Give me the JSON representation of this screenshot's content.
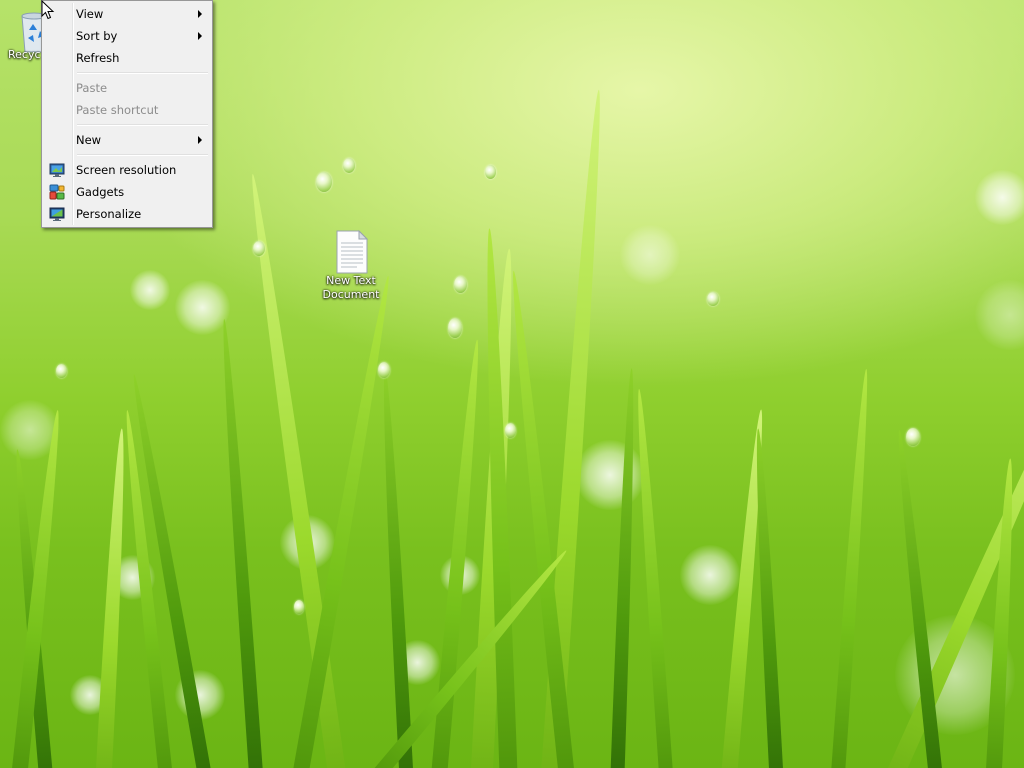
{
  "desktop": {
    "icons": [
      {
        "label": "Recycle Bin",
        "visible_label": "Recyc",
        "icon": "recycle-bin-icon"
      },
      {
        "label": "New Text Document",
        "line1": "New Text",
        "line2": "Document",
        "icon": "text-document-icon"
      }
    ],
    "wallpaper": {
      "accent": "#8fcf2e"
    }
  },
  "context_menu": {
    "items": [
      {
        "label": "View",
        "submenu": true,
        "enabled": true
      },
      {
        "label": "Sort by",
        "submenu": true,
        "enabled": true
      },
      {
        "label": "Refresh",
        "submenu": false,
        "enabled": true
      },
      {
        "label": "Paste",
        "submenu": false,
        "enabled": false
      },
      {
        "label": "Paste shortcut",
        "submenu": false,
        "enabled": false
      },
      {
        "label": "New",
        "submenu": true,
        "enabled": true
      },
      {
        "label": "Screen resolution",
        "icon": "monitor-icon",
        "enabled": true
      },
      {
        "label": "Gadgets",
        "icon": "gadgets-icon",
        "enabled": true
      },
      {
        "label": "Personalize",
        "icon": "personalize-icon",
        "enabled": true
      }
    ]
  }
}
